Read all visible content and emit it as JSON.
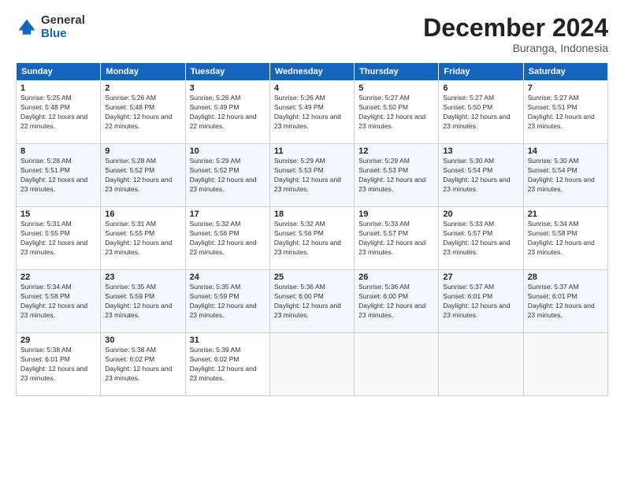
{
  "logo": {
    "general": "General",
    "blue": "Blue"
  },
  "header": {
    "title": "December 2024",
    "subtitle": "Buranga, Indonesia"
  },
  "weekdays": [
    "Sunday",
    "Monday",
    "Tuesday",
    "Wednesday",
    "Thursday",
    "Friday",
    "Saturday"
  ],
  "weeks": [
    [
      {
        "day": "1",
        "sunrise": "5:25 AM",
        "sunset": "5:48 PM",
        "daylight": "12 hours and 22 minutes."
      },
      {
        "day": "2",
        "sunrise": "5:26 AM",
        "sunset": "5:48 PM",
        "daylight": "12 hours and 22 minutes."
      },
      {
        "day": "3",
        "sunrise": "5:26 AM",
        "sunset": "5:49 PM",
        "daylight": "12 hours and 22 minutes."
      },
      {
        "day": "4",
        "sunrise": "5:26 AM",
        "sunset": "5:49 PM",
        "daylight": "12 hours and 23 minutes."
      },
      {
        "day": "5",
        "sunrise": "5:27 AM",
        "sunset": "5:50 PM",
        "daylight": "12 hours and 23 minutes."
      },
      {
        "day": "6",
        "sunrise": "5:27 AM",
        "sunset": "5:50 PM",
        "daylight": "12 hours and 23 minutes."
      },
      {
        "day": "7",
        "sunrise": "5:27 AM",
        "sunset": "5:51 PM",
        "daylight": "12 hours and 23 minutes."
      }
    ],
    [
      {
        "day": "8",
        "sunrise": "5:28 AM",
        "sunset": "5:51 PM",
        "daylight": "12 hours and 23 minutes."
      },
      {
        "day": "9",
        "sunrise": "5:28 AM",
        "sunset": "5:52 PM",
        "daylight": "12 hours and 23 minutes."
      },
      {
        "day": "10",
        "sunrise": "5:29 AM",
        "sunset": "5:52 PM",
        "daylight": "12 hours and 23 minutes."
      },
      {
        "day": "11",
        "sunrise": "5:29 AM",
        "sunset": "5:53 PM",
        "daylight": "12 hours and 23 minutes."
      },
      {
        "day": "12",
        "sunrise": "5:29 AM",
        "sunset": "5:53 PM",
        "daylight": "12 hours and 23 minutes."
      },
      {
        "day": "13",
        "sunrise": "5:30 AM",
        "sunset": "5:54 PM",
        "daylight": "12 hours and 23 minutes."
      },
      {
        "day": "14",
        "sunrise": "5:30 AM",
        "sunset": "5:54 PM",
        "daylight": "12 hours and 23 minutes."
      }
    ],
    [
      {
        "day": "15",
        "sunrise": "5:31 AM",
        "sunset": "5:55 PM",
        "daylight": "12 hours and 23 minutes."
      },
      {
        "day": "16",
        "sunrise": "5:31 AM",
        "sunset": "5:55 PM",
        "daylight": "12 hours and 23 minutes."
      },
      {
        "day": "17",
        "sunrise": "5:32 AM",
        "sunset": "5:56 PM",
        "daylight": "12 hours and 23 minutes."
      },
      {
        "day": "18",
        "sunrise": "5:32 AM",
        "sunset": "5:56 PM",
        "daylight": "12 hours and 23 minutes."
      },
      {
        "day": "19",
        "sunrise": "5:33 AM",
        "sunset": "5:57 PM",
        "daylight": "12 hours and 23 minutes."
      },
      {
        "day": "20",
        "sunrise": "5:33 AM",
        "sunset": "5:57 PM",
        "daylight": "12 hours and 23 minutes."
      },
      {
        "day": "21",
        "sunrise": "5:34 AM",
        "sunset": "5:58 PM",
        "daylight": "12 hours and 23 minutes."
      }
    ],
    [
      {
        "day": "22",
        "sunrise": "5:34 AM",
        "sunset": "5:58 PM",
        "daylight": "12 hours and 23 minutes."
      },
      {
        "day": "23",
        "sunrise": "5:35 AM",
        "sunset": "5:59 PM",
        "daylight": "12 hours and 23 minutes."
      },
      {
        "day": "24",
        "sunrise": "5:35 AM",
        "sunset": "5:59 PM",
        "daylight": "12 hours and 23 minutes."
      },
      {
        "day": "25",
        "sunrise": "5:36 AM",
        "sunset": "6:00 PM",
        "daylight": "12 hours and 23 minutes."
      },
      {
        "day": "26",
        "sunrise": "5:36 AM",
        "sunset": "6:00 PM",
        "daylight": "12 hours and 23 minutes."
      },
      {
        "day": "27",
        "sunrise": "5:37 AM",
        "sunset": "6:01 PM",
        "daylight": "12 hours and 23 minutes."
      },
      {
        "day": "28",
        "sunrise": "5:37 AM",
        "sunset": "6:01 PM",
        "daylight": "12 hours and 23 minutes."
      }
    ],
    [
      {
        "day": "29",
        "sunrise": "5:38 AM",
        "sunset": "6:01 PM",
        "daylight": "12 hours and 23 minutes."
      },
      {
        "day": "30",
        "sunrise": "5:38 AM",
        "sunset": "6:02 PM",
        "daylight": "12 hours and 23 minutes."
      },
      {
        "day": "31",
        "sunrise": "5:39 AM",
        "sunset": "6:02 PM",
        "daylight": "12 hours and 23 minutes."
      },
      null,
      null,
      null,
      null
    ]
  ]
}
